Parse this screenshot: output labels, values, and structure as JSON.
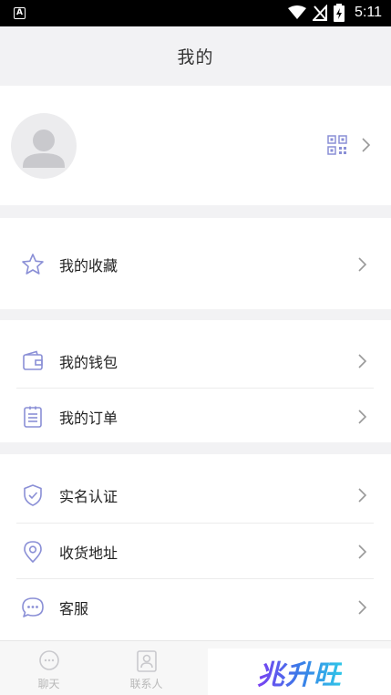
{
  "status_bar": {
    "left_icon_letter": "A",
    "time": "5:11",
    "icons": [
      "wifi-icon",
      "signal-off-icon",
      "battery-charging-icon"
    ]
  },
  "header": {
    "title": "我的"
  },
  "profile": {
    "avatar_icon": "avatar-icon",
    "qr_icon": "qr-code-icon"
  },
  "sections": {
    "favorites": {
      "label": "我的收藏",
      "icon": "star-icon"
    },
    "wallet": {
      "label": "我的钱包",
      "icon": "wallet-icon"
    },
    "orders": {
      "label": "我的订单",
      "icon": "order-icon"
    },
    "real_name": {
      "label": "实名认证",
      "icon": "shield-check-icon"
    },
    "address": {
      "label": "收货地址",
      "icon": "location-pin-icon"
    },
    "customer_service": {
      "label": "客服",
      "icon": "chat-bubble-icon"
    }
  },
  "tabbar": {
    "chat": "聊天",
    "contacts": "联系人"
  },
  "watermark": {
    "text": "兆升旺"
  },
  "colors": {
    "icon_accent": "#8a8fd6",
    "background": "#f2f2f4"
  }
}
